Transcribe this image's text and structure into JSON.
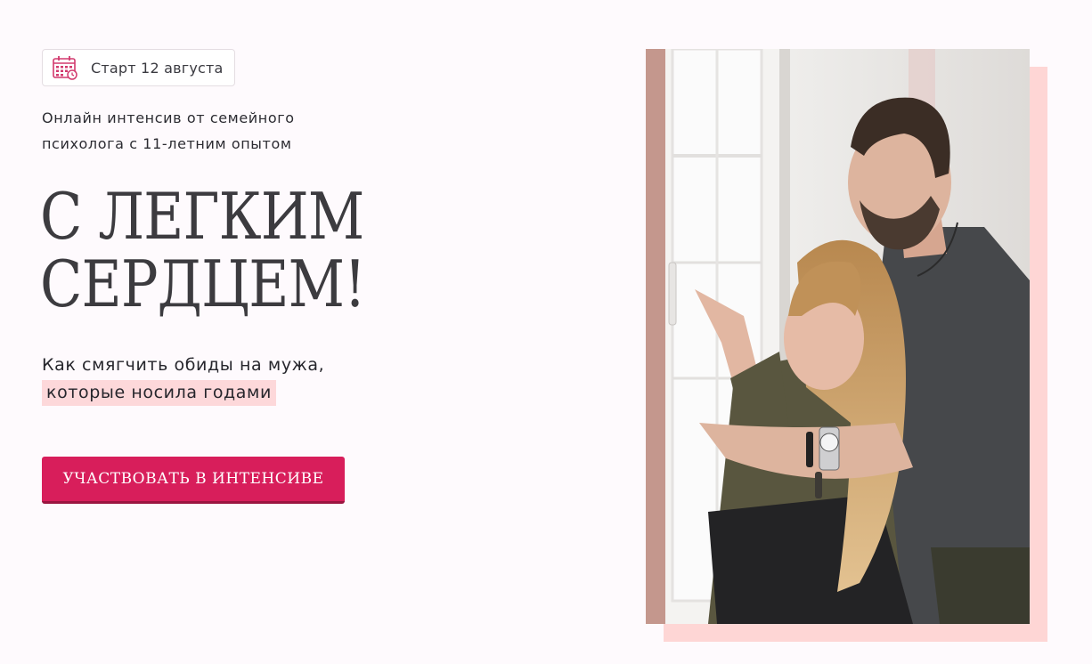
{
  "badge": {
    "icon": "calendar-icon",
    "text": "Старт 12 августа"
  },
  "intro": {
    "line1": "Онлайн интенсив от семейного",
    "line2": "психолога с 11-летним опытом"
  },
  "headline": {
    "line1": "С ЛЕГКИМ",
    "line2": "СЕРДЦЕМ!"
  },
  "subtitle": {
    "line1": "Как смягчить обиды на мужа,",
    "line2_highlight": "которые носила годами"
  },
  "cta": {
    "label": "УЧАСТВОВАТЬ В ИНТЕНСИВЕ"
  },
  "photo": {
    "alt": "couple-by-window-photo"
  },
  "colors": {
    "accent": "#d81e5b",
    "highlight": "#fdd8da",
    "photo_shadow": "#fed6d5",
    "background": "#fefafd"
  }
}
